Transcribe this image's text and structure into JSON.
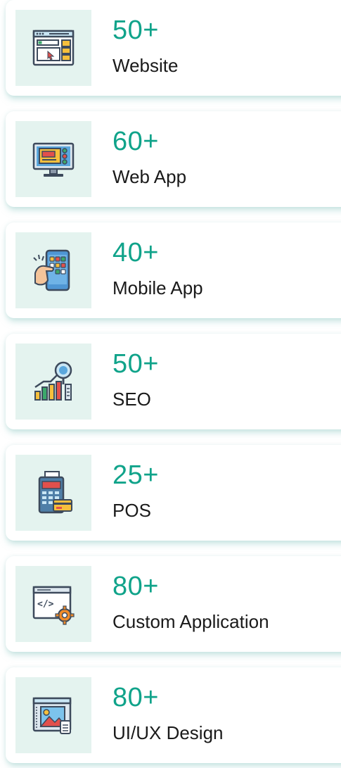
{
  "services": [
    {
      "count": "50+",
      "label": "Website",
      "icon": "website-icon"
    },
    {
      "count": "60+",
      "label": "Web App",
      "icon": "web-app-icon"
    },
    {
      "count": "40+",
      "label": "Mobile App",
      "icon": "mobile-app-icon"
    },
    {
      "count": "50+",
      "label": "SEO",
      "icon": "seo-icon"
    },
    {
      "count": "25+",
      "label": "POS",
      "icon": "pos-icon"
    },
    {
      "count": "80+",
      "label": "Custom Application",
      "icon": "custom-application-icon"
    },
    {
      "count": "80+",
      "label": "UI/UX Design",
      "icon": "ui-ux-design-icon"
    }
  ],
  "colors": {
    "accent": "#10a38a",
    "icon_bg": "#e4f3ef",
    "text": "#1a1a1a"
  }
}
